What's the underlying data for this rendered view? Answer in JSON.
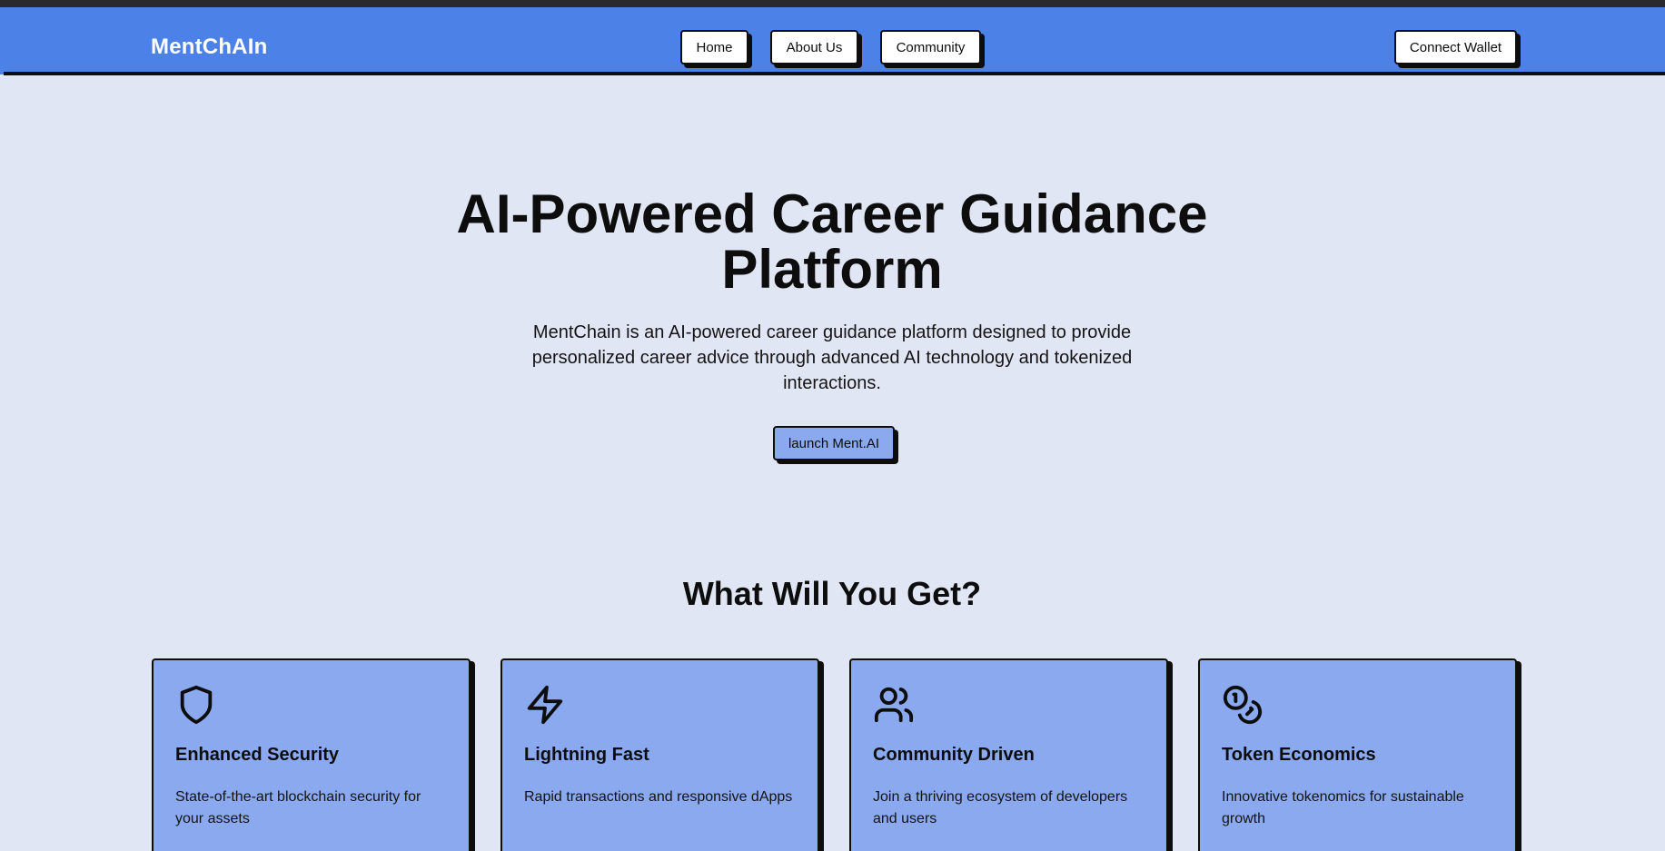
{
  "header": {
    "brand": "MentChAIn",
    "nav": {
      "home": "Home",
      "about": "About Us",
      "community": "Community"
    },
    "connect_wallet": "Connect Wallet"
  },
  "hero": {
    "title": "AI-Powered Career Guidance Platform",
    "description": "MentChain is an AI-powered career guidance platform designed to provide personalized career advice through advanced AI technology and tokenized interactions.",
    "cta": "launch Ment.AI"
  },
  "features": {
    "heading": "What Will You Get?",
    "items": [
      {
        "icon": "shield-icon",
        "title": "Enhanced Security",
        "description": "State-of-the-art blockchain security for your assets"
      },
      {
        "icon": "lightning-icon",
        "title": "Lightning Fast",
        "description": "Rapid transactions and responsive dApps"
      },
      {
        "icon": "users-icon",
        "title": "Community Driven",
        "description": "Join a thriving ecosystem of developers and users"
      },
      {
        "icon": "coins-icon",
        "title": "Token Economics",
        "description": "Innovative tokenomics for sustainable growth"
      }
    ]
  },
  "colors": {
    "navbar": "#4c82e8",
    "page_background": "#e0e6f3",
    "card": "#8aa9ef",
    "button": "#ffffff",
    "outline": "#0d0d0d"
  }
}
